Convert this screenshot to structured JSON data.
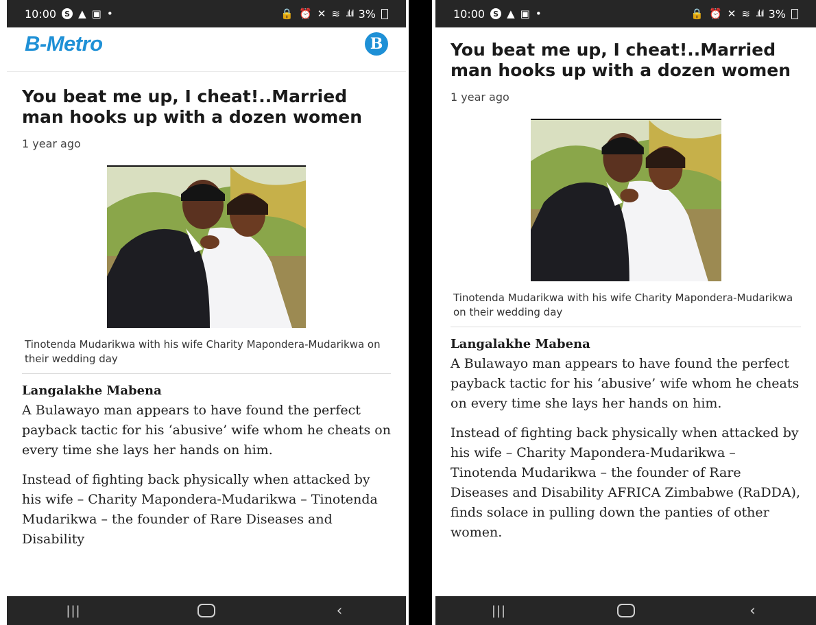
{
  "status_bar": {
    "time": "10:00",
    "battery": "3%"
  },
  "app": {
    "logo": "B-Metro",
    "brand_letter": "B",
    "accent": "#1e90d6"
  },
  "article": {
    "headline": "You beat me up, I cheat!..Married man hooks up with a dozen women",
    "timestamp": "1 year ago",
    "caption": "Tinotenda Mudarikwa with his wife Charity Mapondera-Mudarikwa on their wedding day",
    "author": "Langalakhe Mabena",
    "paragraphs": [
      "A Bulawayo man appears to have found the perfect payback tactic for his ‘abusive’ wife whom he cheats on every time she lays her hands on him.",
      "Instead of fighting back physically when attacked by his wife – Charity Mapondera-Mudarikwa – Tinotenda Mudarikwa – the founder of Rare Diseases and Disability",
      "Instead of fighting back physically when attacked by his wife – Charity Mapondera-Mudarikwa – Tinotenda Mudarikwa – the founder of Rare Diseases and Disability AFRICA Zimbabwe (RaDDA), finds solace in pulling down the panties of other women."
    ]
  },
  "icons": {
    "nav": [
      "recents-icon",
      "home-icon",
      "back-icon"
    ]
  }
}
